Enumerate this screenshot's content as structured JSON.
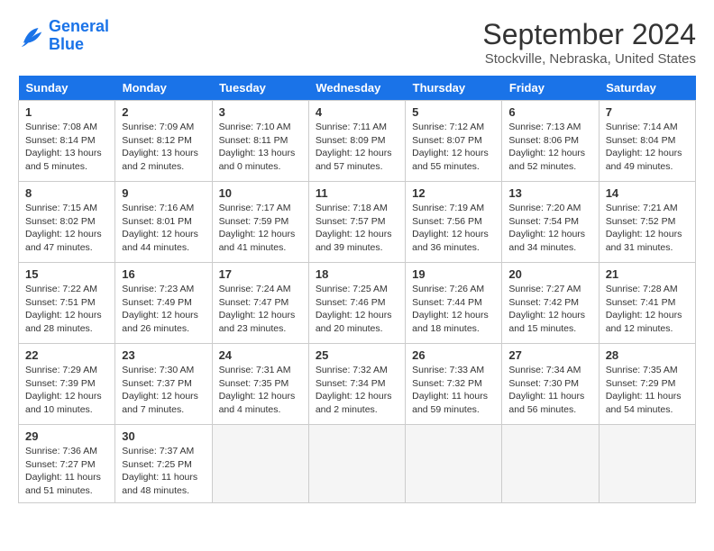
{
  "header": {
    "logo_line1": "General",
    "logo_line2": "Blue",
    "month_title": "September 2024",
    "subtitle": "Stockville, Nebraska, United States"
  },
  "weekdays": [
    "Sunday",
    "Monday",
    "Tuesday",
    "Wednesday",
    "Thursday",
    "Friday",
    "Saturday"
  ],
  "weeks": [
    [
      {
        "day": "1",
        "info": "Sunrise: 7:08 AM\nSunset: 8:14 PM\nDaylight: 13 hours and 5 minutes."
      },
      {
        "day": "2",
        "info": "Sunrise: 7:09 AM\nSunset: 8:12 PM\nDaylight: 13 hours and 2 minutes."
      },
      {
        "day": "3",
        "info": "Sunrise: 7:10 AM\nSunset: 8:11 PM\nDaylight: 13 hours and 0 minutes."
      },
      {
        "day": "4",
        "info": "Sunrise: 7:11 AM\nSunset: 8:09 PM\nDaylight: 12 hours and 57 minutes."
      },
      {
        "day": "5",
        "info": "Sunrise: 7:12 AM\nSunset: 8:07 PM\nDaylight: 12 hours and 55 minutes."
      },
      {
        "day": "6",
        "info": "Sunrise: 7:13 AM\nSunset: 8:06 PM\nDaylight: 12 hours and 52 minutes."
      },
      {
        "day": "7",
        "info": "Sunrise: 7:14 AM\nSunset: 8:04 PM\nDaylight: 12 hours and 49 minutes."
      }
    ],
    [
      {
        "day": "8",
        "info": "Sunrise: 7:15 AM\nSunset: 8:02 PM\nDaylight: 12 hours and 47 minutes."
      },
      {
        "day": "9",
        "info": "Sunrise: 7:16 AM\nSunset: 8:01 PM\nDaylight: 12 hours and 44 minutes."
      },
      {
        "day": "10",
        "info": "Sunrise: 7:17 AM\nSunset: 7:59 PM\nDaylight: 12 hours and 41 minutes."
      },
      {
        "day": "11",
        "info": "Sunrise: 7:18 AM\nSunset: 7:57 PM\nDaylight: 12 hours and 39 minutes."
      },
      {
        "day": "12",
        "info": "Sunrise: 7:19 AM\nSunset: 7:56 PM\nDaylight: 12 hours and 36 minutes."
      },
      {
        "day": "13",
        "info": "Sunrise: 7:20 AM\nSunset: 7:54 PM\nDaylight: 12 hours and 34 minutes."
      },
      {
        "day": "14",
        "info": "Sunrise: 7:21 AM\nSunset: 7:52 PM\nDaylight: 12 hours and 31 minutes."
      }
    ],
    [
      {
        "day": "15",
        "info": "Sunrise: 7:22 AM\nSunset: 7:51 PM\nDaylight: 12 hours and 28 minutes."
      },
      {
        "day": "16",
        "info": "Sunrise: 7:23 AM\nSunset: 7:49 PM\nDaylight: 12 hours and 26 minutes."
      },
      {
        "day": "17",
        "info": "Sunrise: 7:24 AM\nSunset: 7:47 PM\nDaylight: 12 hours and 23 minutes."
      },
      {
        "day": "18",
        "info": "Sunrise: 7:25 AM\nSunset: 7:46 PM\nDaylight: 12 hours and 20 minutes."
      },
      {
        "day": "19",
        "info": "Sunrise: 7:26 AM\nSunset: 7:44 PM\nDaylight: 12 hours and 18 minutes."
      },
      {
        "day": "20",
        "info": "Sunrise: 7:27 AM\nSunset: 7:42 PM\nDaylight: 12 hours and 15 minutes."
      },
      {
        "day": "21",
        "info": "Sunrise: 7:28 AM\nSunset: 7:41 PM\nDaylight: 12 hours and 12 minutes."
      }
    ],
    [
      {
        "day": "22",
        "info": "Sunrise: 7:29 AM\nSunset: 7:39 PM\nDaylight: 12 hours and 10 minutes."
      },
      {
        "day": "23",
        "info": "Sunrise: 7:30 AM\nSunset: 7:37 PM\nDaylight: 12 hours and 7 minutes."
      },
      {
        "day": "24",
        "info": "Sunrise: 7:31 AM\nSunset: 7:35 PM\nDaylight: 12 hours and 4 minutes."
      },
      {
        "day": "25",
        "info": "Sunrise: 7:32 AM\nSunset: 7:34 PM\nDaylight: 12 hours and 2 minutes."
      },
      {
        "day": "26",
        "info": "Sunrise: 7:33 AM\nSunset: 7:32 PM\nDaylight: 11 hours and 59 minutes."
      },
      {
        "day": "27",
        "info": "Sunrise: 7:34 AM\nSunset: 7:30 PM\nDaylight: 11 hours and 56 minutes."
      },
      {
        "day": "28",
        "info": "Sunrise: 7:35 AM\nSunset: 7:29 PM\nDaylight: 11 hours and 54 minutes."
      }
    ],
    [
      {
        "day": "29",
        "info": "Sunrise: 7:36 AM\nSunset: 7:27 PM\nDaylight: 11 hours and 51 minutes."
      },
      {
        "day": "30",
        "info": "Sunrise: 7:37 AM\nSunset: 7:25 PM\nDaylight: 11 hours and 48 minutes."
      },
      {
        "day": "",
        "info": ""
      },
      {
        "day": "",
        "info": ""
      },
      {
        "day": "",
        "info": ""
      },
      {
        "day": "",
        "info": ""
      },
      {
        "day": "",
        "info": ""
      }
    ]
  ]
}
